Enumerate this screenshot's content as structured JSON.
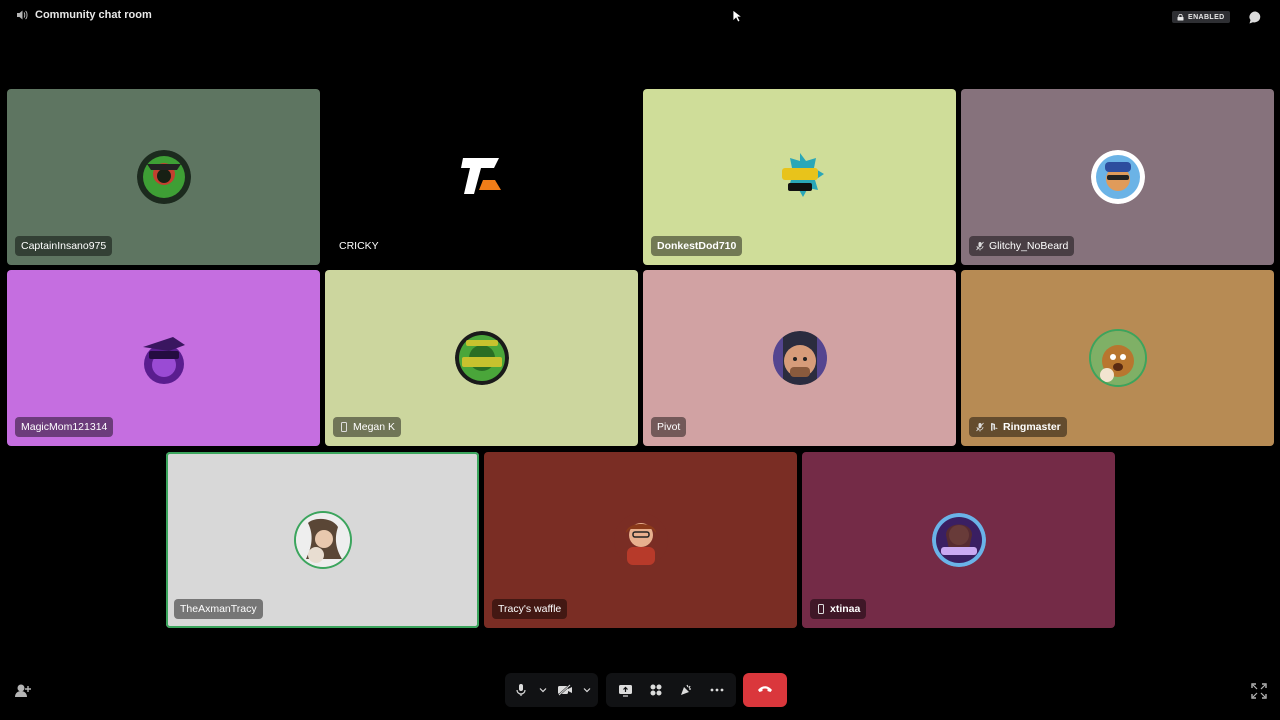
{
  "room": {
    "title": "Community chat room",
    "icon": "speaker-icon"
  },
  "status": {
    "enabled_label": "ENABLED"
  },
  "participants": [
    {
      "name": "CaptainInsano975",
      "bg": "#5e7561"
    },
    {
      "name": "CRICKY",
      "bg": "#000000"
    },
    {
      "name": "DonkestDod710",
      "bg": "#cfdd99"
    },
    {
      "name": "Glitchy_NoBeard",
      "bg": "#86727c"
    },
    {
      "name": "MagicMom121314",
      "bg": "#c56ee0"
    },
    {
      "name": "Megan K",
      "bg": "#ccd69e"
    },
    {
      "name": "Pivot",
      "bg": "#d1a2a3"
    },
    {
      "name": "Ringmaster",
      "bg": "#b78b54"
    },
    {
      "name": "TheAxmanTracy",
      "bg": "#d8d8d8"
    },
    {
      "name": "Tracy's waffle",
      "bg": "#7a2d24"
    },
    {
      "name": "xtinaa",
      "bg": "#742b47"
    }
  ],
  "controls": {
    "mic": "microphone-icon",
    "camera": "camera-off-icon",
    "screen_share": "screen-share-icon",
    "activities": "activities-icon",
    "soundboard": "soundboard-icon",
    "more": "more-icon",
    "disconnect": "phone-hangup-icon"
  },
  "colors": {
    "speaking": "#3ba55d",
    "disconnect": "#da373c"
  }
}
